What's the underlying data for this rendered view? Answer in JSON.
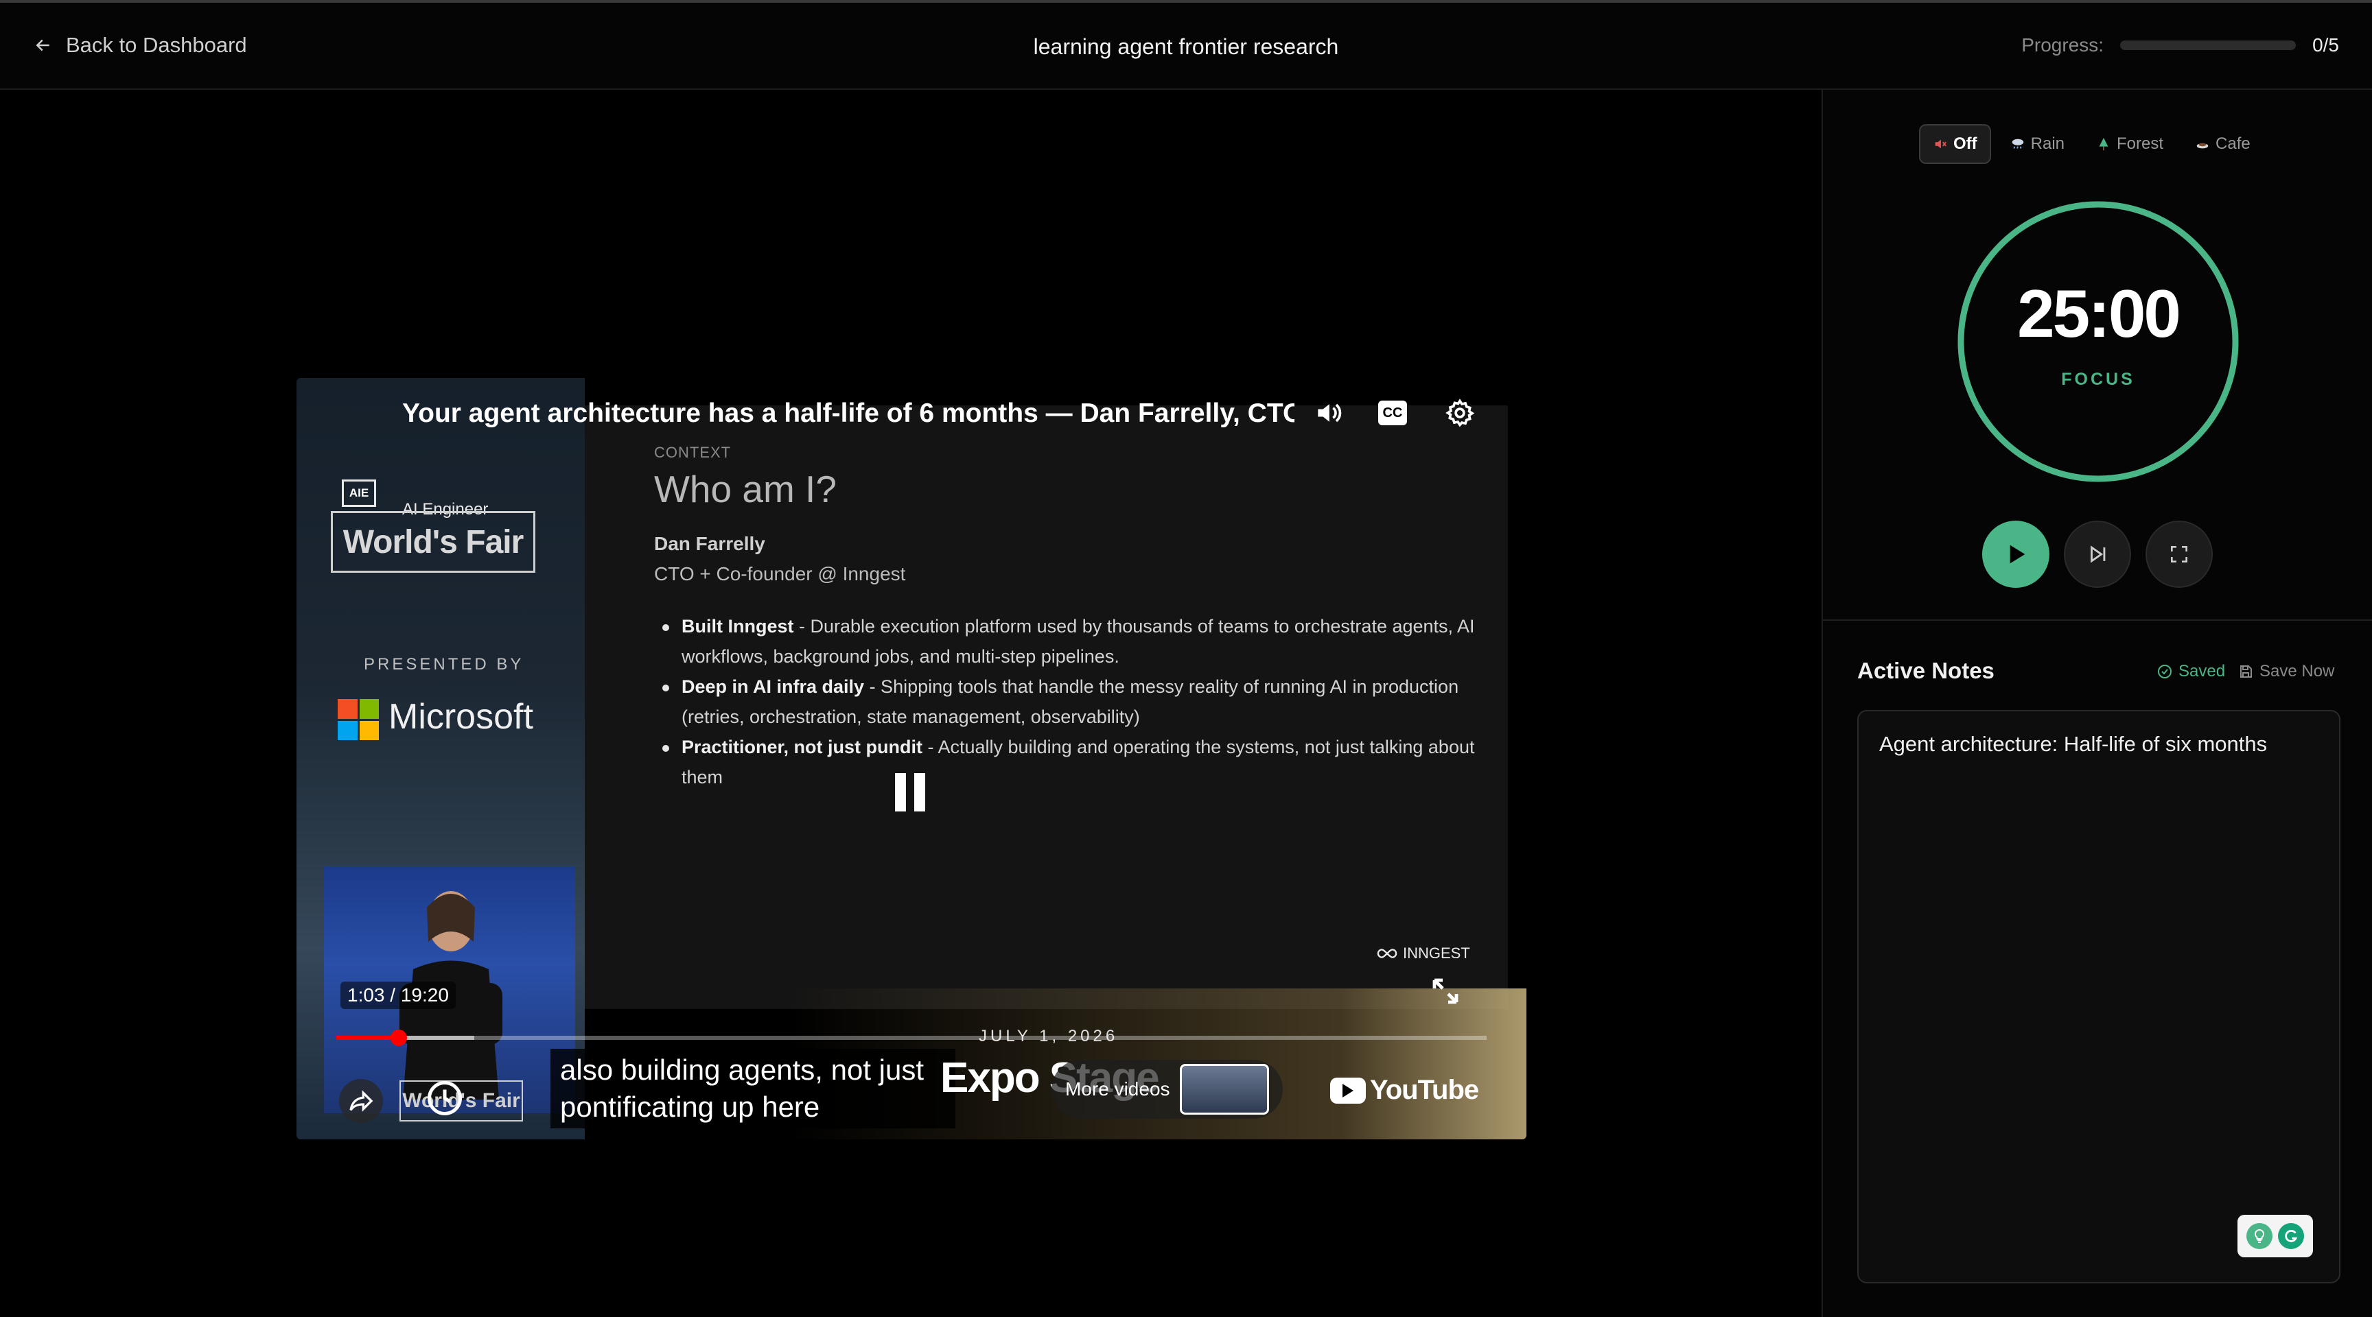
{
  "header": {
    "back_label": "Back to Dashboard",
    "title": "learning agent frontier research",
    "progress_label": "Progress:",
    "progress_count": "0/5",
    "progress_fraction": 0.0
  },
  "video": {
    "title": "Your agent architecture has a half-life of 6 months — Dan Farrelly, CTO,",
    "poster": {
      "logo": "AIE",
      "ai_engineer": "AI Engineer",
      "worlds_fair": "World's Fair",
      "presented_by": "PRESENTED BY",
      "sponsor": "Microsoft"
    },
    "slide": {
      "context_label": "CONTEXT",
      "heading": "Who am I?",
      "person_name": "Dan Farrelly",
      "person_role": "CTO + Co-founder @ Inngest",
      "bullets": [
        {
          "bold": "Built Inngest",
          "text": " - Durable execution platform used by thousands of teams to orchestrate agents, AI workflows, background jobs, and multi-step pipelines."
        },
        {
          "bold": "Deep in AI infra daily",
          "text": " - Shipping tools that handle the messy reality of running AI in production (retries, orchestration, state management, observability)"
        },
        {
          "bold": "Practitioner, not just pundit",
          "text": " - Actually building and operating the systems, not just talking about them"
        }
      ],
      "brand": "INNGEST"
    },
    "time_display": "1:03 / 19:20",
    "date": "JULY 1, 2026",
    "played_fraction": 0.054,
    "loaded_fraction": 0.12,
    "caption_line1": "also building agents, not just",
    "caption_line2": "pontificating up here",
    "stage": "Expo Stage",
    "watch_later_text": "World's Fair",
    "more_videos_label": "More videos",
    "youtube_label": "YouTube",
    "colors": {
      "played": "#ff0000"
    }
  },
  "sidebar": {
    "sound_tabs": [
      {
        "icon": "muted-icon",
        "label": "Off",
        "active": true
      },
      {
        "icon": "rain-icon",
        "label": "Rain",
        "active": false
      },
      {
        "icon": "tree-icon",
        "label": "Forest",
        "active": false
      },
      {
        "icon": "coffee-icon",
        "label": "Cafe",
        "active": false
      }
    ],
    "timer": {
      "time": "25:00",
      "mode": "FOCUS",
      "remaining_fraction": 1.0
    },
    "notes": {
      "title": "Active Notes",
      "saved_label": "Saved",
      "save_now_label": "Save Now",
      "content": "Agent architecture: Half-life of six months"
    },
    "colors": {
      "accent": "#4ab586"
    }
  }
}
